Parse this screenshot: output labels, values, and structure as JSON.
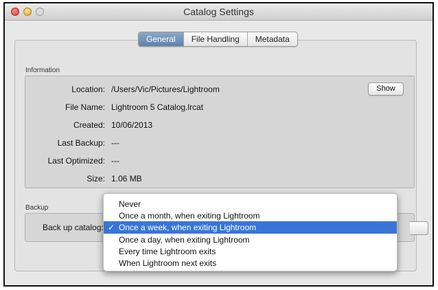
{
  "window": {
    "title": "Catalog Settings"
  },
  "tabs": [
    {
      "label": "General",
      "active": true
    },
    {
      "label": "File Handling",
      "active": false
    },
    {
      "label": "Metadata",
      "active": false
    }
  ],
  "information": {
    "section_label": "Information",
    "rows": [
      {
        "label": "Location:",
        "value": "/Users/Vic/Pictures/Lightroom"
      },
      {
        "label": "File Name:",
        "value": "Lightroom 5 Catalog.lrcat"
      },
      {
        "label": "Created:",
        "value": "10/06/2013"
      },
      {
        "label": "Last Backup:",
        "value": "---"
      },
      {
        "label": "Last Optimized:",
        "value": "---"
      },
      {
        "label": "Size:",
        "value": "1.06 MB"
      }
    ],
    "show_button": "Show"
  },
  "backup": {
    "section_label": "Backup",
    "label": "Back up catalog:",
    "menu_items": [
      {
        "label": "Never",
        "selected": false
      },
      {
        "label": "Once a month, when exiting Lightroom",
        "selected": false
      },
      {
        "label": "Once a week, when exiting Lightroom",
        "selected": true,
        "check": "✓"
      },
      {
        "label": "Once a day, when exiting Lightroom",
        "selected": false
      },
      {
        "label": "Every time Lightroom exits",
        "selected": false
      },
      {
        "label": "When Lightroom next exits",
        "selected": false
      }
    ]
  },
  "colors": {
    "selection": "#3875d7",
    "active_tab": "#6f90b8"
  }
}
